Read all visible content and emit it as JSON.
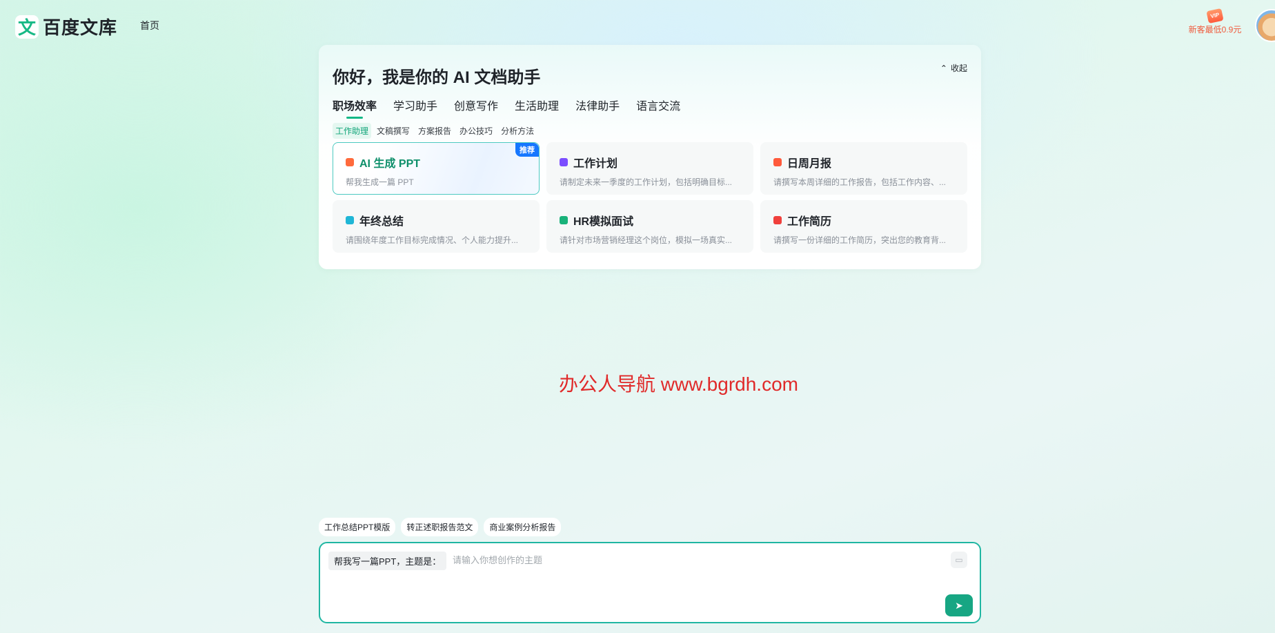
{
  "header": {
    "logo_glyph": "文",
    "logo_text": "百度文库",
    "nav_home": "首页",
    "vip_badge": "VIP",
    "vip_text": "新客最低0.9元"
  },
  "card": {
    "title": "你好，我是你的 AI 文档助手",
    "collapse_label": "收起",
    "tabs": [
      {
        "label": "职场效率",
        "active": true
      },
      {
        "label": "学习助手"
      },
      {
        "label": "创意写作"
      },
      {
        "label": "生活助理"
      },
      {
        "label": "法律助手"
      },
      {
        "label": "语言交流"
      }
    ],
    "subtabs": [
      {
        "label": "工作助理",
        "active": true
      },
      {
        "label": "文稿撰写"
      },
      {
        "label": "方案报告"
      },
      {
        "label": "办公技巧"
      },
      {
        "label": "分析方法"
      }
    ],
    "tiles": [
      {
        "title": "AI 生成 PPT",
        "desc": "帮我生成一篇 PPT",
        "badge": "推荐",
        "icon": "ppt-icon",
        "color": "#ff6a3c"
      },
      {
        "title": "工作计划",
        "desc": "请制定未来一季度的工作计划，包括明确目标...",
        "icon": "plan-icon",
        "color": "#7b4dff"
      },
      {
        "title": "日周月报",
        "desc": "请撰写本周详细的工作报告，包括工作内容、...",
        "icon": "report-icon",
        "color": "#ff5a3c"
      },
      {
        "title": "年终总结",
        "desc": "请围绕年度工作目标完成情况、个人能力提升...",
        "icon": "summary-icon",
        "color": "#1fb6d6"
      },
      {
        "title": "HR模拟面试",
        "desc": "请针对市场营销经理这个岗位，模拟一场真实...",
        "icon": "interview-icon",
        "color": "#19b27a"
      },
      {
        "title": "工作简历",
        "desc": "请撰写一份详细的工作简历，突出您的教育背...",
        "icon": "resume-icon",
        "color": "#f0403c"
      }
    ]
  },
  "watermark": "办公人导航 www.bgrdh.com",
  "suggestions": [
    "工作总结PPT模版",
    "转正述职报告范文",
    "商业案例分析报告"
  ],
  "input": {
    "prefix": "帮我写一篇PPT，主题是：",
    "placeholder": "请输入你想创作的主题"
  }
}
